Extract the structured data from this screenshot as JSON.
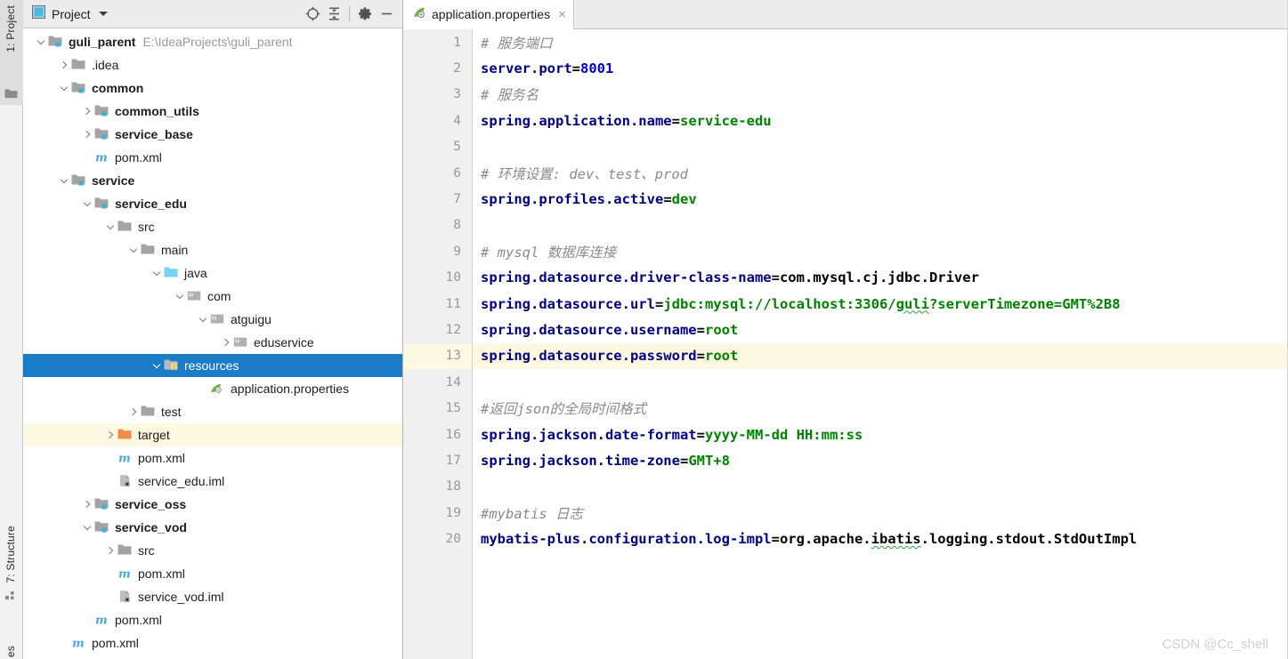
{
  "tool_strip": {
    "top_label": "1: Project",
    "structure_label": "7: Structure",
    "favorites_label": "es"
  },
  "project_panel": {
    "title": "Project",
    "buttons": [
      {
        "name": "locate-icon",
        "label": "Select Opened File"
      },
      {
        "name": "collapse-all-icon",
        "label": "Collapse All"
      },
      {
        "name": "gear-icon",
        "label": "Settings"
      },
      {
        "name": "minimize-icon",
        "label": "Hide"
      }
    ],
    "tree": [
      {
        "label": "guli_parent",
        "path": "E:\\IdeaProjects\\guli_parent",
        "indent": 0,
        "arrow": "down",
        "icon": "module-folder",
        "bold": true,
        "state": "normal"
      },
      {
        "label": ".idea",
        "path": "",
        "indent": 1,
        "arrow": "right",
        "icon": "folder",
        "bold": false,
        "state": "normal"
      },
      {
        "label": "common",
        "path": "",
        "indent": 1,
        "arrow": "down",
        "icon": "module-folder",
        "bold": true,
        "state": "normal"
      },
      {
        "label": "common_utils",
        "path": "",
        "indent": 2,
        "arrow": "right",
        "icon": "module-folder",
        "bold": true,
        "state": "normal"
      },
      {
        "label": "service_base",
        "path": "",
        "indent": 2,
        "arrow": "right",
        "icon": "module-folder",
        "bold": true,
        "state": "normal"
      },
      {
        "label": "pom.xml",
        "path": "",
        "indent": 2,
        "arrow": "none",
        "icon": "maven",
        "bold": false,
        "state": "normal"
      },
      {
        "label": "service",
        "path": "",
        "indent": 1,
        "arrow": "down",
        "icon": "module-folder",
        "bold": true,
        "state": "normal"
      },
      {
        "label": "service_edu",
        "path": "",
        "indent": 2,
        "arrow": "down",
        "icon": "module-folder",
        "bold": true,
        "state": "normal"
      },
      {
        "label": "src",
        "path": "",
        "indent": 3,
        "arrow": "down",
        "icon": "folder",
        "bold": false,
        "state": "normal"
      },
      {
        "label": "main",
        "path": "",
        "indent": 4,
        "arrow": "down",
        "icon": "folder",
        "bold": false,
        "state": "normal"
      },
      {
        "label": "java",
        "path": "",
        "indent": 5,
        "arrow": "down",
        "icon": "source-folder",
        "bold": false,
        "state": "normal"
      },
      {
        "label": "com",
        "path": "",
        "indent": 6,
        "arrow": "down",
        "icon": "package",
        "bold": false,
        "state": "normal"
      },
      {
        "label": "atguigu",
        "path": "",
        "indent": 7,
        "arrow": "down",
        "icon": "package",
        "bold": false,
        "state": "normal"
      },
      {
        "label": "eduservice",
        "path": "",
        "indent": 8,
        "arrow": "right",
        "icon": "package",
        "bold": false,
        "state": "normal"
      },
      {
        "label": "resources",
        "path": "",
        "indent": 5,
        "arrow": "down",
        "icon": "resource-folder",
        "bold": false,
        "state": "selected"
      },
      {
        "label": "application.properties",
        "path": "",
        "indent": 7,
        "arrow": "none",
        "icon": "spring",
        "bold": false,
        "state": "normal"
      },
      {
        "label": "test",
        "path": "",
        "indent": 4,
        "arrow": "right",
        "icon": "folder",
        "bold": false,
        "state": "normal"
      },
      {
        "label": "target",
        "path": "",
        "indent": 3,
        "arrow": "right",
        "icon": "excluded-folder",
        "bold": false,
        "state": "highlight"
      },
      {
        "label": "pom.xml",
        "path": "",
        "indent": 3,
        "arrow": "none",
        "icon": "maven",
        "bold": false,
        "state": "normal"
      },
      {
        "label": "service_edu.iml",
        "path": "",
        "indent": 3,
        "arrow": "none",
        "icon": "iml",
        "bold": false,
        "state": "normal"
      },
      {
        "label": "service_oss",
        "path": "",
        "indent": 2,
        "arrow": "right",
        "icon": "module-folder",
        "bold": true,
        "state": "normal"
      },
      {
        "label": "service_vod",
        "path": "",
        "indent": 2,
        "arrow": "down",
        "icon": "module-folder",
        "bold": true,
        "state": "normal"
      },
      {
        "label": "src",
        "path": "",
        "indent": 3,
        "arrow": "right",
        "icon": "folder",
        "bold": false,
        "state": "normal"
      },
      {
        "label": "pom.xml",
        "path": "",
        "indent": 3,
        "arrow": "none",
        "icon": "maven",
        "bold": false,
        "state": "normal"
      },
      {
        "label": "service_vod.iml",
        "path": "",
        "indent": 3,
        "arrow": "none",
        "icon": "iml",
        "bold": false,
        "state": "normal"
      },
      {
        "label": "pom.xml",
        "path": "",
        "indent": 2,
        "arrow": "none",
        "icon": "maven",
        "bold": false,
        "state": "normal"
      },
      {
        "label": "pom.xml",
        "path": "",
        "indent": 1,
        "arrow": "none",
        "icon": "maven",
        "bold": false,
        "state": "normal"
      }
    ]
  },
  "editor": {
    "tab": {
      "label": "application.properties",
      "close": "×",
      "icon": "spring-icon"
    },
    "caret_line": 13,
    "watermark": "CSDN @Cc_shell",
    "lines": [
      {
        "n": 1,
        "tokens": [
          {
            "t": "comment",
            "s": "# 服务端口"
          }
        ]
      },
      {
        "n": 2,
        "tokens": [
          {
            "t": "key",
            "s": "server.port"
          },
          {
            "t": "eq",
            "s": "="
          },
          {
            "t": "num",
            "s": "8001"
          }
        ]
      },
      {
        "n": 3,
        "tokens": [
          {
            "t": "comment",
            "s": "# 服务名"
          }
        ]
      },
      {
        "n": 4,
        "tokens": [
          {
            "t": "key",
            "s": "spring.application.name"
          },
          {
            "t": "eq",
            "s": "="
          },
          {
            "t": "val",
            "s": "service-edu"
          }
        ]
      },
      {
        "n": 5,
        "tokens": []
      },
      {
        "n": 6,
        "tokens": [
          {
            "t": "comment",
            "s": "# 环境设置: dev、test、prod"
          }
        ]
      },
      {
        "n": 7,
        "tokens": [
          {
            "t": "key",
            "s": "spring.profiles.active"
          },
          {
            "t": "eq",
            "s": "="
          },
          {
            "t": "val",
            "s": "dev"
          }
        ]
      },
      {
        "n": 8,
        "tokens": []
      },
      {
        "n": 9,
        "tokens": [
          {
            "t": "comment",
            "s": "# mysql 数据库连接"
          }
        ]
      },
      {
        "n": 10,
        "tokens": [
          {
            "t": "key",
            "s": "spring.datasource.driver-class-name"
          },
          {
            "t": "eq",
            "s": "="
          },
          {
            "t": "plain",
            "s": "com.mysql.cj.jdbc.Driver"
          }
        ]
      },
      {
        "n": 11,
        "tokens": [
          {
            "t": "key",
            "s": "spring.datasource.url"
          },
          {
            "t": "eq",
            "s": "="
          },
          {
            "t": "val",
            "s": "jdbc:mysql://localhost:3306/"
          },
          {
            "t": "val-squiggle",
            "s": "guli"
          },
          {
            "t": "val",
            "s": "?serverTimezone=GMT%2B8"
          }
        ]
      },
      {
        "n": 12,
        "tokens": [
          {
            "t": "key",
            "s": "spring.datasource.username"
          },
          {
            "t": "eq",
            "s": "="
          },
          {
            "t": "val",
            "s": "root"
          }
        ]
      },
      {
        "n": 13,
        "tokens": [
          {
            "t": "key",
            "s": "spring.datasource.password"
          },
          {
            "t": "eq",
            "s": "="
          },
          {
            "t": "val",
            "s": "root"
          }
        ]
      },
      {
        "n": 14,
        "tokens": []
      },
      {
        "n": 15,
        "tokens": [
          {
            "t": "comment",
            "s": "#返回json的全局时间格式"
          }
        ]
      },
      {
        "n": 16,
        "tokens": [
          {
            "t": "key",
            "s": "spring.jackson.date-format"
          },
          {
            "t": "eq",
            "s": "="
          },
          {
            "t": "val",
            "s": "yyyy-MM-dd HH:mm:ss"
          }
        ]
      },
      {
        "n": 17,
        "tokens": [
          {
            "t": "key",
            "s": "spring.jackson.time-zone"
          },
          {
            "t": "eq",
            "s": "="
          },
          {
            "t": "val",
            "s": "GMT+8"
          }
        ]
      },
      {
        "n": 18,
        "tokens": []
      },
      {
        "n": 19,
        "tokens": [
          {
            "t": "comment",
            "s": "#mybatis 日志"
          }
        ]
      },
      {
        "n": 20,
        "tokens": [
          {
            "t": "key",
            "s": "mybatis-plus.configuration.log-impl"
          },
          {
            "t": "eq",
            "s": "="
          },
          {
            "t": "plain",
            "s": "org.apache."
          },
          {
            "t": "plain-squiggle",
            "s": "ibatis"
          },
          {
            "t": "plain",
            "s": ".logging.stdout.StdOutImpl"
          }
        ]
      }
    ]
  },
  "colors": {
    "selection": "#1a7cc7",
    "caret_line": "#fdf8e1",
    "comment": "#8a8a8a",
    "key": "#000080",
    "value": "#008000",
    "number": "#0000c8"
  }
}
